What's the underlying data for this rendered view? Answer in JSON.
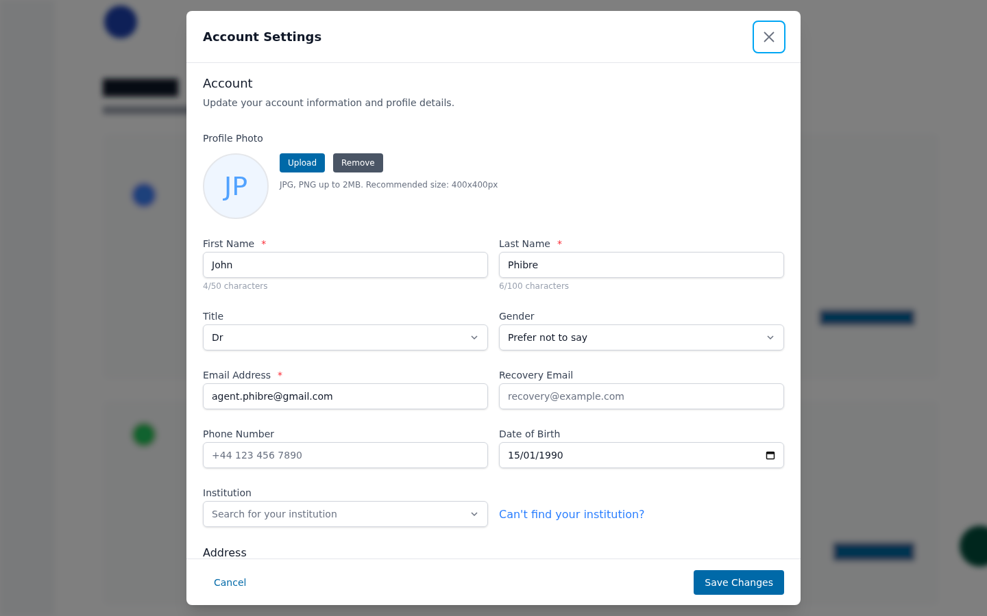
{
  "dialog": {
    "title": "Account Settings",
    "close_focused": true
  },
  "section": {
    "title": "Account",
    "subtitle": "Update your account information and profile details."
  },
  "profile_photo": {
    "label": "Profile Photo",
    "initials": "JP",
    "buttons": [
      {
        "label": "Upload",
        "kind": "primary"
      },
      {
        "label": "Remove",
        "kind": "secondary"
      }
    ],
    "hint": "JPG, PNG up to 2MB. Recommended size: 400x400px"
  },
  "rows": [
    [
      {
        "kind": "text",
        "label": "First Name",
        "required_mark": "*",
        "value": "John",
        "counter": "4/50 characters"
      },
      {
        "kind": "text",
        "label": "Last Name",
        "required_mark": "*",
        "value": "Phibre",
        "counter": "6/100 characters"
      }
    ],
    [
      {
        "kind": "select",
        "label": "Title",
        "value": "Dr"
      },
      {
        "kind": "select",
        "label": "Gender",
        "value": "Prefer not to say"
      }
    ],
    [
      {
        "kind": "text",
        "label": "Email Address",
        "required_mark": "*",
        "value": "agent.phibre@gmail.com"
      },
      {
        "kind": "text",
        "label": "Recovery Email",
        "placeholder": "recovery@example.com"
      }
    ],
    [
      {
        "kind": "text",
        "label": "Phone Number",
        "placeholder": "+44 123 456 7890"
      },
      {
        "kind": "date",
        "label": "Date of Birth",
        "value": "15/01/1990"
      }
    ],
    [
      {
        "kind": "select",
        "label": "Institution",
        "placeholder": "Search for your institution"
      },
      {
        "kind": "link",
        "text": "Can't find your institution?"
      }
    ]
  ],
  "next_section": {
    "title": "Address"
  },
  "footer": {
    "cancel": "Cancel",
    "save": "Save Changes"
  }
}
